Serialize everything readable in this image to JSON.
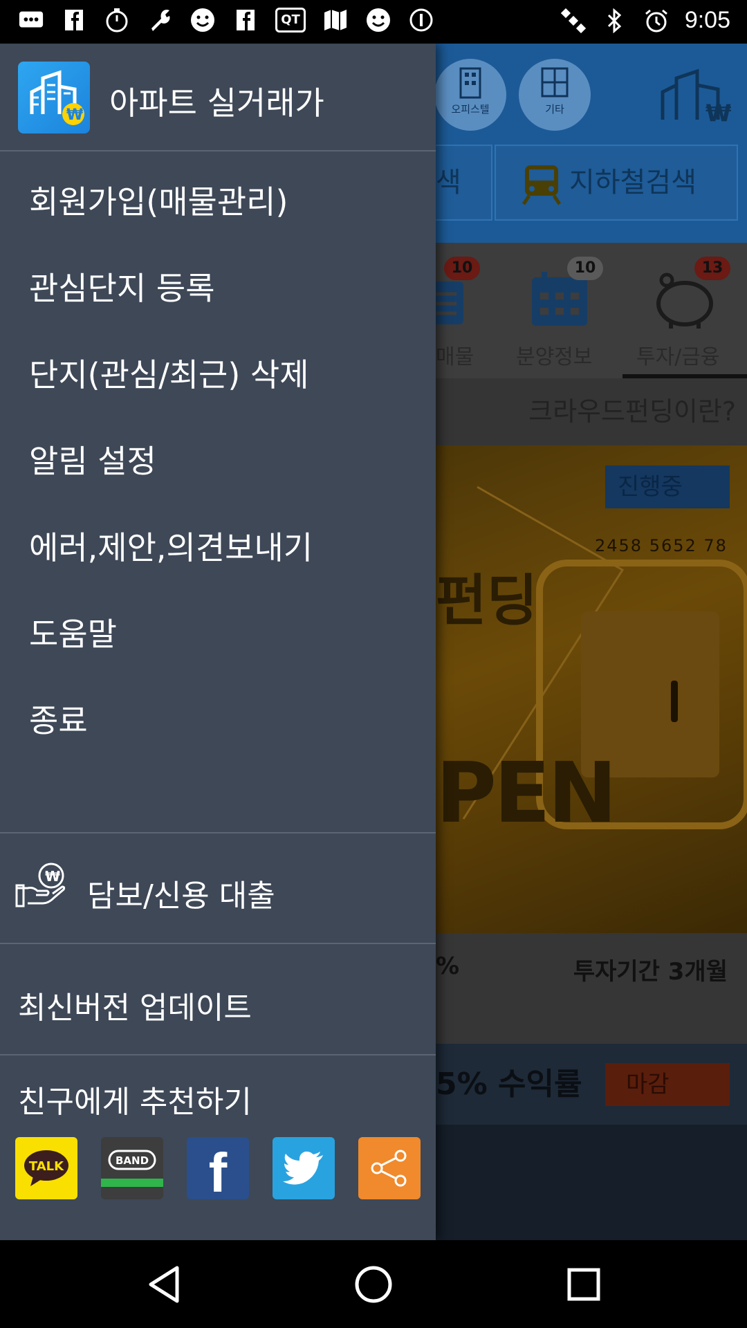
{
  "status_bar": {
    "time": "9:05",
    "icons": [
      "chat-bubbles-icon",
      "facebook-icon",
      "timer-icon",
      "wrench-icon",
      "smiley-icon",
      "facebook-icon",
      "qt-icon",
      "map-icon",
      "smiley-icon",
      "info-circle-icon",
      "satellite-icon",
      "bluetooth-icon",
      "alarm-icon"
    ]
  },
  "drawer": {
    "app_title": "아파트 실거래가",
    "menu_items": [
      "회원가입(매물관리)",
      "관심단지 등록",
      "단지(관심/최근) 삭제",
      "알림 설정",
      "에러,제안,의견보내기",
      "도움말",
      "종료"
    ],
    "loan_label": "담보/신용 대출",
    "update_label": "최신버전 업데이트",
    "recommend_label": "친구에게 추천하기",
    "share": {
      "kakaotalk": "TALK",
      "band": "BAND",
      "facebook": "f",
      "twitter_icon": "twitter-bird-icon",
      "share_icon": "share-icon",
      "colors": {
        "kakaotalk": "#f9e000",
        "band": "#3d3d3d",
        "facebook": "#2a4f8c",
        "twitter": "#29a3e0",
        "share": "#f08a2c"
      }
    }
  },
  "background_app": {
    "circle_labels": [
      "오피스텔",
      "기타"
    ],
    "subway_search": "지하철검색",
    "subway_search_partial": "색",
    "tabs": [
      "매물",
      "분양정보",
      "투자/금융"
    ],
    "badges": [
      "10",
      "10",
      "13"
    ],
    "crowdfunding": "크라우드펀딩이란?",
    "status_ongoing": "진행중",
    "card_numbers": "2458  5652  78",
    "banner_text_partial": "PEN",
    "banner_text_funding": "펀딩",
    "invest_period": "투자기간 3개월",
    "percent_partial": "%",
    "yield_text": "5% 수익률",
    "status_closed": "마감"
  },
  "theme": {
    "drawer_bg": "#3e4857",
    "accent_blue": "#1f8de8"
  }
}
